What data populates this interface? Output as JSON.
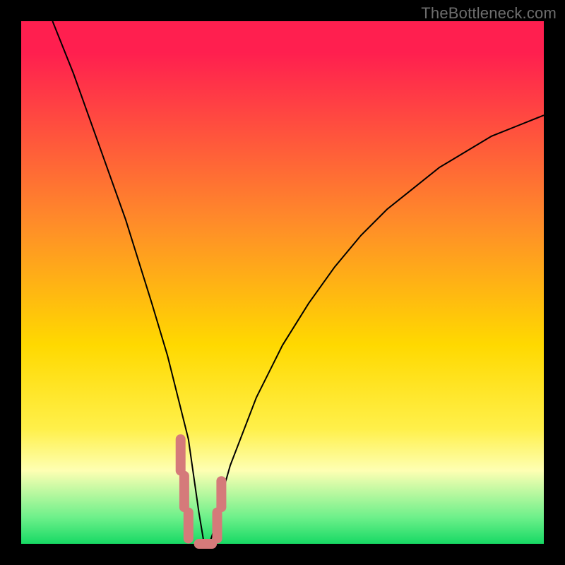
{
  "watermark": "TheBottleneck.com",
  "colors": {
    "red": "#ff1f4f",
    "orange": "#ff8a2a",
    "yellow": "#ffd900",
    "yellow2": "#fff04a",
    "lightyellow": "#feffb3",
    "lightgreen": "#6cf08a",
    "green": "#17d964",
    "marker": "#d57a7a",
    "curve": "#000000"
  },
  "chart_data": {
    "type": "line",
    "title": "",
    "xlabel": "",
    "ylabel": "",
    "xlim": [
      0,
      100
    ],
    "ylim": [
      0,
      100
    ],
    "note": "Values eyeballed from pixel positions; curve is bottleneck-style V reaching ~0 at x≈35.",
    "series": [
      {
        "name": "bottleneck-curve",
        "x": [
          6,
          10,
          15,
          20,
          25,
          28,
          30,
          32,
          33,
          34,
          35,
          36,
          37,
          38,
          40,
          45,
          50,
          55,
          60,
          65,
          70,
          75,
          80,
          85,
          90,
          95,
          100
        ],
        "values": [
          100,
          90,
          76,
          62,
          46,
          36,
          28,
          20,
          13,
          6,
          0,
          0,
          3,
          8,
          15,
          28,
          38,
          46,
          53,
          59,
          64,
          68,
          72,
          75,
          78,
          80,
          82
        ]
      }
    ],
    "markers": {
      "name": "highlighted-range",
      "color": "#d57a7a",
      "description": "Thick salmon dashed markers near the curve minimum",
      "segments": [
        {
          "x": 30.5,
          "y1": 20,
          "y2": 14
        },
        {
          "x": 31.2,
          "y1": 13,
          "y2": 7
        },
        {
          "x": 32.0,
          "y1": 6,
          "y2": 1
        },
        {
          "x": 34.0,
          "y1": 0,
          "y2": 0,
          "x2": 36.5
        },
        {
          "x": 37.5,
          "y1": 1,
          "y2": 6
        },
        {
          "x": 38.3,
          "y1": 7,
          "y2": 12
        }
      ]
    }
  }
}
